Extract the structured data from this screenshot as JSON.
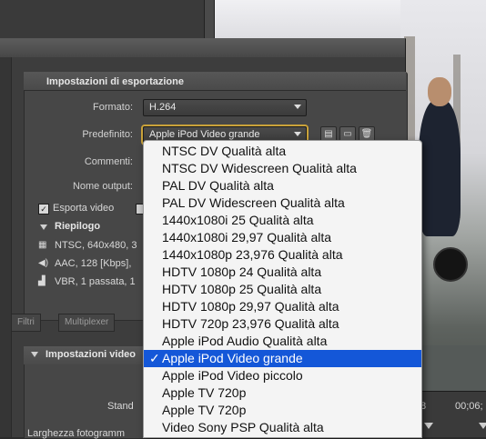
{
  "dialog": {
    "export_section_title": "Impostazioni di esportazione",
    "format_label": "Formato:",
    "format_value": "H.264",
    "preset_label": "Predefinito:",
    "preset_value": "Apple iPod Video grande",
    "comments_label": "Commenti:",
    "output_name_label": "Nome output:",
    "export_video_label": "Esporta video",
    "export_video_checked": true,
    "summary_label": "Riepilogo",
    "summary_video": "NTSC, 640x480, 3",
    "summary_audio": "AAC, 128 [Kbps],",
    "summary_bitrate": "VBR, 1 passata, 1",
    "tabs": [
      "Filtri",
      "Multiplexer"
    ],
    "video_settings_title": "Impostazioni video",
    "partial_label_1": "Stand",
    "partial_label_2": "Larghezza fotogramm"
  },
  "timeline": {
    "timecode": "00;06;",
    "marker": "8"
  },
  "menu": {
    "items": [
      "NTSC DV Qualità alta",
      "NTSC DV Widescreen Qualità alta",
      "PAL DV Qualità alta",
      "PAL DV Widescreen Qualità alta",
      "1440x1080i 25 Qualità alta",
      "1440x1080i 29,97 Qualità alta",
      "1440x1080p 23,976 Qualità alta",
      "HDTV 1080p 24 Qualità alta",
      "HDTV 1080p 25 Qualità alta",
      "HDTV 1080p 29,97 Qualità alta",
      "HDTV 720p 23,976 Qualità alta",
      "Apple iPod Audio Qualità alta",
      "Apple iPod Video grande",
      "Apple iPod Video piccolo",
      "Apple TV 720p",
      "Apple TV 720p",
      "Video Sony PSP Qualità alta"
    ],
    "selected_index": 12,
    "check_glyph": "✓"
  },
  "icons": [
    "save-preset-icon",
    "import-preset-icon",
    "delete-preset-icon",
    "film-icon",
    "speaker-icon",
    "bitrate-icon",
    "disclosure-triangle-icon"
  ],
  "colors": {
    "selection": "#1457d8",
    "focus_ring": "#c9a23a",
    "menu_bg": "#f4f4f4",
    "dialog_bg": "#3d3d3d"
  }
}
